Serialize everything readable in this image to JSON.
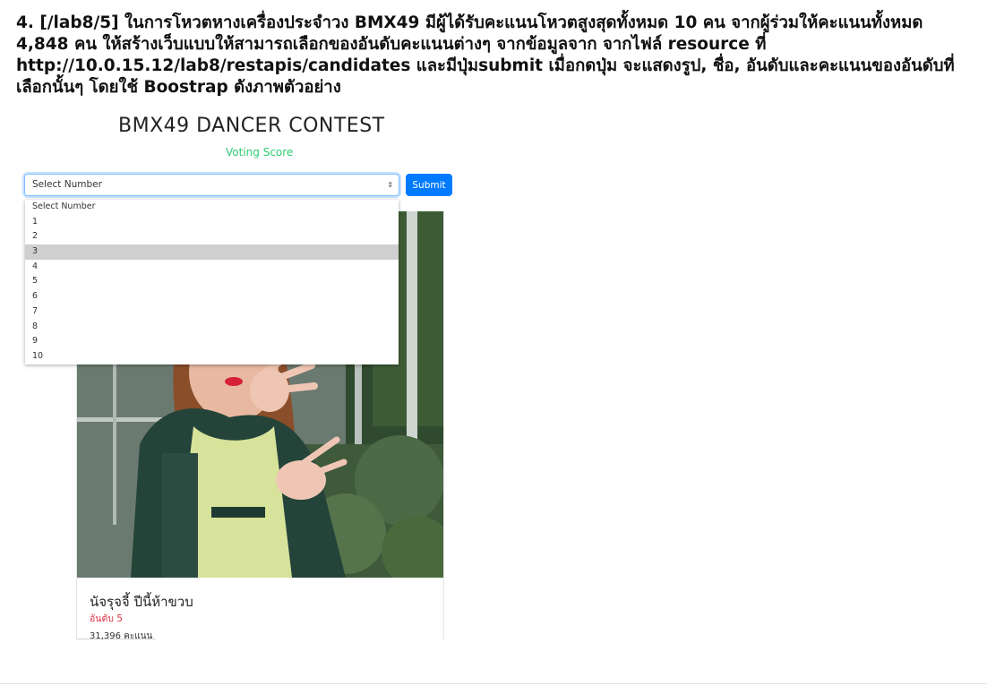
{
  "question": {
    "line1": "4. [/lab8/5] ในการโหวตหางเครื่องประจำวง BMX49 มีผู้ได้รับคะแนนโหวตสูงสุดทั้งหมด 10 คน จากผู้ร่วมให้คะแนนทั้งหมด",
    "line2": "4,848 คน ให้สร้างเว็บแบบให้สามารถเลือกของอันดับคะแนนต่างๆ จากข้อมูลจาก จากไฟล์ resource ที่",
    "line3": "http://10.0.15.12/lab8/restapis/candidates และมีปุ่มsubmit เมื่อกดปุ่ม จะแสดงรูป, ชื่อ, อันดับและคะแนนของอันดับที่",
    "line4": "เลือกนั้นๆ โดยใช้ Boostrap ดังภาพตัวอย่าง"
  },
  "app": {
    "title": "BMX49 DANCER CONTEST",
    "subtitle": "Voting Score",
    "select_value": "Select Number",
    "select_arrow": "⇕",
    "submit_label": "Submit"
  },
  "dropdown": {
    "options": [
      "Select Number",
      "1",
      "2",
      "3",
      "4",
      "5",
      "6",
      "7",
      "8",
      "9",
      "10"
    ],
    "highlighted": "3"
  },
  "card": {
    "name": "นัจรุจจี้ ปีนี้ห้าขวบ",
    "rank": "อันดับ 5",
    "score": "31,396 คะแนน"
  },
  "colors": {
    "accent": "#007bff",
    "subtitle": "#2ecc71",
    "rank": "#dc3545"
  }
}
